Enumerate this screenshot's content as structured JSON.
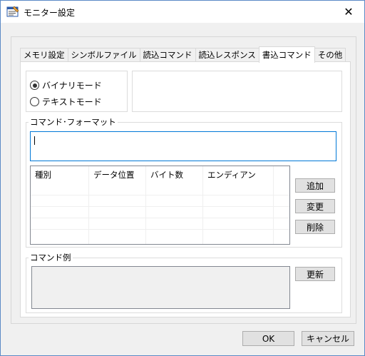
{
  "window": {
    "title": "モニター設定",
    "close_glyph": "✕"
  },
  "tabs": [
    {
      "label": "メモリ設定",
      "active": false
    },
    {
      "label": "シンボルファイル",
      "active": false
    },
    {
      "label": "読込コマンド",
      "active": false
    },
    {
      "label": "読込レスポンス",
      "active": false
    },
    {
      "label": "書込コマンド",
      "active": true
    },
    {
      "label": "その他",
      "active": false
    }
  ],
  "mode": {
    "options": [
      {
        "label": "バイナリモード",
        "checked": true
      },
      {
        "label": "テキストモード",
        "checked": false
      }
    ]
  },
  "command_format": {
    "label": "コマンド･フォーマット",
    "value": ""
  },
  "field_table": {
    "columns": [
      "種別",
      "データ位置",
      "バイト数",
      "エンディアン"
    ],
    "rows": []
  },
  "side_buttons": {
    "add": "追加",
    "change": "変更",
    "delete": "削除"
  },
  "command_example": {
    "label": "コマンド例",
    "value": "",
    "update_button": "更新"
  },
  "footer": {
    "ok": "OK",
    "cancel": "キャンセル"
  },
  "colors": {
    "focus_border": "#0078d7",
    "button_bg": "#e1e1e1",
    "window_bg": "#f0f0f0"
  }
}
